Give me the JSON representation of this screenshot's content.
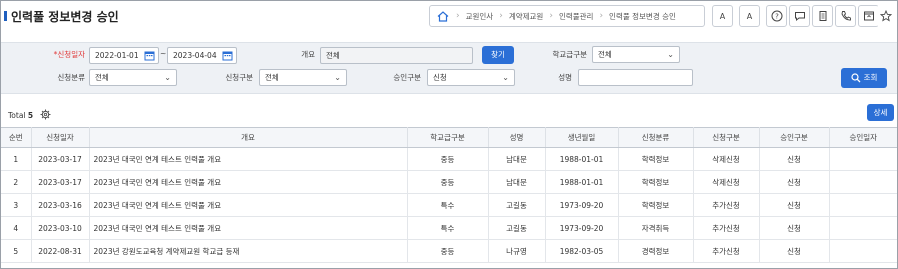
{
  "page": {
    "title": "인력풀 정보변경 승인"
  },
  "breadcrumb": {
    "home_icon": "home-icon",
    "items": [
      "교원인사",
      "계약제교원",
      "인력풀관리",
      "인력풀 정보변경 승인"
    ]
  },
  "header_buttons": [
    {
      "name": "font-increase-button",
      "label": "A"
    },
    {
      "name": "font-decrease-button",
      "label": "A"
    },
    {
      "name": "help-button",
      "icon": "question-icon"
    },
    {
      "name": "chat-button",
      "icon": "chat-icon"
    },
    {
      "name": "copy-button",
      "icon": "copy-icon"
    },
    {
      "name": "document-button",
      "icon": "document-icon"
    },
    {
      "name": "phone-button",
      "icon": "phone-icon"
    },
    {
      "name": "window-button",
      "icon": "window-icon"
    },
    {
      "name": "favorite-button",
      "icon": "star-icon"
    }
  ],
  "search": {
    "apply_date_label": "신청일자",
    "date_from": "2022-01-01",
    "date_sep": "~",
    "date_to": "2023-04-04",
    "summary_label": "개요",
    "summary_value": "전체",
    "find_button": "찾기",
    "school_level_label": "학교급구분",
    "school_level_value": "전체",
    "apply_category_label": "신청분류",
    "apply_category_value": "전체",
    "apply_type_label": "신청구분",
    "apply_type_value": "전체",
    "approve_type_label": "승인구분",
    "approve_type_value": "신청",
    "name_label": "성명",
    "name_value": "",
    "search_button": "조회"
  },
  "list": {
    "total_label": "Total",
    "total_count": "5",
    "detail_button": "상세"
  },
  "table": {
    "headers": [
      "순번",
      "신청일자",
      "개요",
      "학교급구분",
      "성명",
      "생년월일",
      "신청분류",
      "신청구분",
      "승인구분",
      "승인일자"
    ],
    "rows": [
      [
        "1",
        "2023-03-17",
        "2023년 대국민 연계 테스트 인력풀 개요",
        "중등",
        "남대문",
        "1988-01-01",
        "학력정보",
        "삭제신청",
        "신청",
        ""
      ],
      [
        "2",
        "2023-03-17",
        "2023년 대국민 연계 테스트 인력풀 개요",
        "중등",
        "남대문",
        "1988-01-01",
        "학력정보",
        "삭제신청",
        "신청",
        ""
      ],
      [
        "3",
        "2023-03-16",
        "2023년 대국민 연계 테스트 인력풀 개요",
        "특수",
        "고길동",
        "1973-09-20",
        "학력정보",
        "추가신청",
        "신청",
        ""
      ],
      [
        "4",
        "2023-03-10",
        "2023년 대국민 연계 테스트 인력풀 개요",
        "특수",
        "고길동",
        "1973-09-20",
        "자격취득",
        "추가신청",
        "신청",
        ""
      ],
      [
        "5",
        "2022-08-31",
        "2023년 강원도교육청 계약제교원 학교급 등재",
        "중등",
        "나규영",
        "1982-03-05",
        "경력정보",
        "추가신청",
        "신청",
        ""
      ]
    ]
  },
  "colors": {
    "accent": "#2b6fd6",
    "required": "#e03a3a"
  }
}
